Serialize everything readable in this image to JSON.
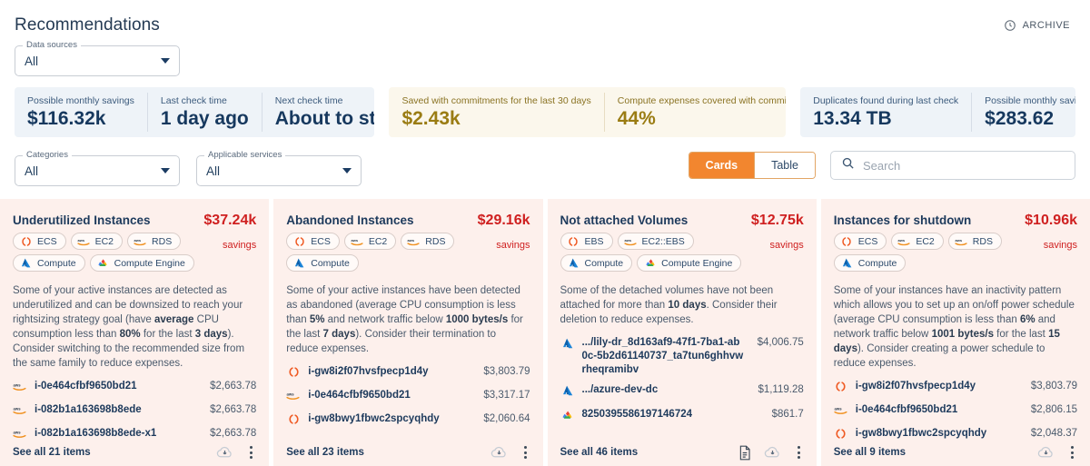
{
  "header": {
    "title": "Recommendations",
    "archive_label": "ARCHIVE",
    "archive_icon": "archive-clock-icon"
  },
  "filters": {
    "data_sources": {
      "legend": "Data sources",
      "value": "All"
    },
    "categories": {
      "legend": "Categories",
      "value": "All"
    },
    "applicable_services": {
      "legend": "Applicable services",
      "value": "All"
    }
  },
  "stats": {
    "group_blue_left": [
      {
        "label": "Possible monthly savings",
        "value": "$116.32k"
      },
      {
        "label": "Last check time",
        "value": "1 day ago"
      },
      {
        "label": "Next check time",
        "value": "About to start"
      }
    ],
    "group_gold": [
      {
        "label": "Saved with commitments for the last 30 days",
        "value": "$2.43k"
      },
      {
        "label": "Compute expenses covered with commitments",
        "value": "44%"
      }
    ],
    "group_blue_right": [
      {
        "label": "Duplicates found during last check",
        "value": "13.34 TB"
      },
      {
        "label": "Possible monthly savings",
        "value": "$283.62"
      }
    ]
  },
  "toolbar": {
    "view_cards": "Cards",
    "view_table": "Table",
    "active_view": "Cards",
    "search_placeholder": "Search",
    "search_value": "",
    "accent_color": "#f2862f"
  },
  "cards": [
    {
      "title": "Underutilized Instances",
      "savings_amount": "$37.24k",
      "savings_label": "savings",
      "badges": [
        {
          "label": "ECS",
          "icon": "ecs-icon"
        },
        {
          "label": "EC2",
          "icon": "aws-icon"
        },
        {
          "label": "RDS",
          "icon": "aws-icon"
        },
        {
          "label": "Compute",
          "icon": "azure-icon"
        },
        {
          "label": "Compute Engine",
          "icon": "gcp-icon"
        }
      ],
      "description": [
        {
          "t": "Some of your active instances are detected as underutilized and can be downsized to reach your rightsizing strategy goal (have ",
          "b": false
        },
        {
          "t": "average",
          "b": true
        },
        {
          "t": " CPU consumption less than ",
          "b": false
        },
        {
          "t": "80%",
          "b": true
        },
        {
          "t": " for the last ",
          "b": false
        },
        {
          "t": "3 days",
          "b": true
        },
        {
          "t": "). Consider switching to the recommended size from the same family to reduce expenses.",
          "b": false
        }
      ],
      "items": [
        {
          "icon": "aws-icon",
          "name": "i-0e464cfbf9650bd21",
          "cost": "$2,663.78"
        },
        {
          "icon": "aws-icon",
          "name": "i-082b1a163698b8ede",
          "cost": "$2,663.78"
        },
        {
          "icon": "aws-icon",
          "name": "i-082b1a163698b8ede-x1",
          "cost": "$2,663.78"
        }
      ],
      "see_all": "See all 21 items",
      "foot_icons": [
        "download-cloud-icon",
        "kebab-menu-icon"
      ]
    },
    {
      "title": "Abandoned Instances",
      "savings_amount": "$29.16k",
      "savings_label": "savings",
      "badges": [
        {
          "label": "ECS",
          "icon": "ecs-icon"
        },
        {
          "label": "EC2",
          "icon": "aws-icon"
        },
        {
          "label": "RDS",
          "icon": "aws-icon"
        },
        {
          "label": "Compute",
          "icon": "azure-icon"
        }
      ],
      "description": [
        {
          "t": "Some of your active instances have been detected as abandoned (average CPU consumption is less than ",
          "b": false
        },
        {
          "t": "5%",
          "b": true
        },
        {
          "t": " and network traffic below ",
          "b": false
        },
        {
          "t": "1000 bytes/s",
          "b": true
        },
        {
          "t": " for the last ",
          "b": false
        },
        {
          "t": "7 days",
          "b": true
        },
        {
          "t": "). Consider their termination to reduce expenses.",
          "b": false
        }
      ],
      "items": [
        {
          "icon": "ecs-icon",
          "name": "i-gw8i2f07hvsfpecp1d4y",
          "cost": "$3,803.79"
        },
        {
          "icon": "aws-icon",
          "name": "i-0e464cfbf9650bd21",
          "cost": "$3,317.17"
        },
        {
          "icon": "ecs-icon",
          "name": "i-gw8bwy1fbwc2spcyqhdy",
          "cost": "$2,060.64"
        }
      ],
      "see_all": "See all 23 items",
      "foot_icons": [
        "download-cloud-icon",
        "kebab-menu-icon"
      ]
    },
    {
      "title": "Not attached Volumes",
      "savings_amount": "$12.75k",
      "savings_label": "savings",
      "badges": [
        {
          "label": "EBS",
          "icon": "ecs-icon"
        },
        {
          "label": "EC2::EBS",
          "icon": "aws-icon"
        },
        {
          "label": "Compute",
          "icon": "azure-icon"
        },
        {
          "label": "Compute Engine",
          "icon": "gcp-icon"
        }
      ],
      "description": [
        {
          "t": "Some of the detached volumes have not been attached for more than ",
          "b": false
        },
        {
          "t": "10 days",
          "b": true
        },
        {
          "t": ". Consider their deletion to reduce expenses.",
          "b": false
        }
      ],
      "items": [
        {
          "icon": "azure-icon",
          "name": ".../lily-dr_8d163af9-47f1-7ba1-ab0c-5b2d61140737_ta7tun6ghhvwrheqramibv",
          "cost": "$4,006.75"
        },
        {
          "icon": "azure-icon",
          "name": ".../azure-dev-dc",
          "cost": "$1,119.28"
        },
        {
          "icon": "gcp-icon",
          "name": "8250395586197146724",
          "cost": "$861.7"
        }
      ],
      "see_all": "See all 46 items",
      "foot_icons": [
        "document-icon",
        "download-cloud-icon",
        "kebab-menu-icon"
      ]
    },
    {
      "title": "Instances for shutdown",
      "savings_amount": "$10.96k",
      "savings_label": "savings",
      "badges": [
        {
          "label": "ECS",
          "icon": "ecs-icon"
        },
        {
          "label": "EC2",
          "icon": "aws-icon"
        },
        {
          "label": "RDS",
          "icon": "aws-icon"
        },
        {
          "label": "Compute",
          "icon": "azure-icon"
        }
      ],
      "description": [
        {
          "t": "Some of your instances have an inactivity pattern which allows you to set up an on/off power schedule (average CPU consumption is less than ",
          "b": false
        },
        {
          "t": "6%",
          "b": true
        },
        {
          "t": " and network traffic below ",
          "b": false
        },
        {
          "t": "1001 bytes/s",
          "b": true
        },
        {
          "t": " for the last ",
          "b": false
        },
        {
          "t": "15 days",
          "b": true
        },
        {
          "t": "). Consider creating a power schedule to reduce expenses.",
          "b": false
        }
      ],
      "items": [
        {
          "icon": "ecs-icon",
          "name": "i-gw8i2f07hvsfpecp1d4y",
          "cost": "$3,803.79"
        },
        {
          "icon": "aws-icon",
          "name": "i-0e464cfbf9650bd21",
          "cost": "$2,806.15"
        },
        {
          "icon": "ecs-icon",
          "name": "i-gw8bwy1fbwc2spcyqhdy",
          "cost": "$2,048.37"
        }
      ],
      "see_all": "See all 9 items",
      "foot_icons": [
        "download-cloud-icon",
        "kebab-menu-icon"
      ]
    }
  ]
}
